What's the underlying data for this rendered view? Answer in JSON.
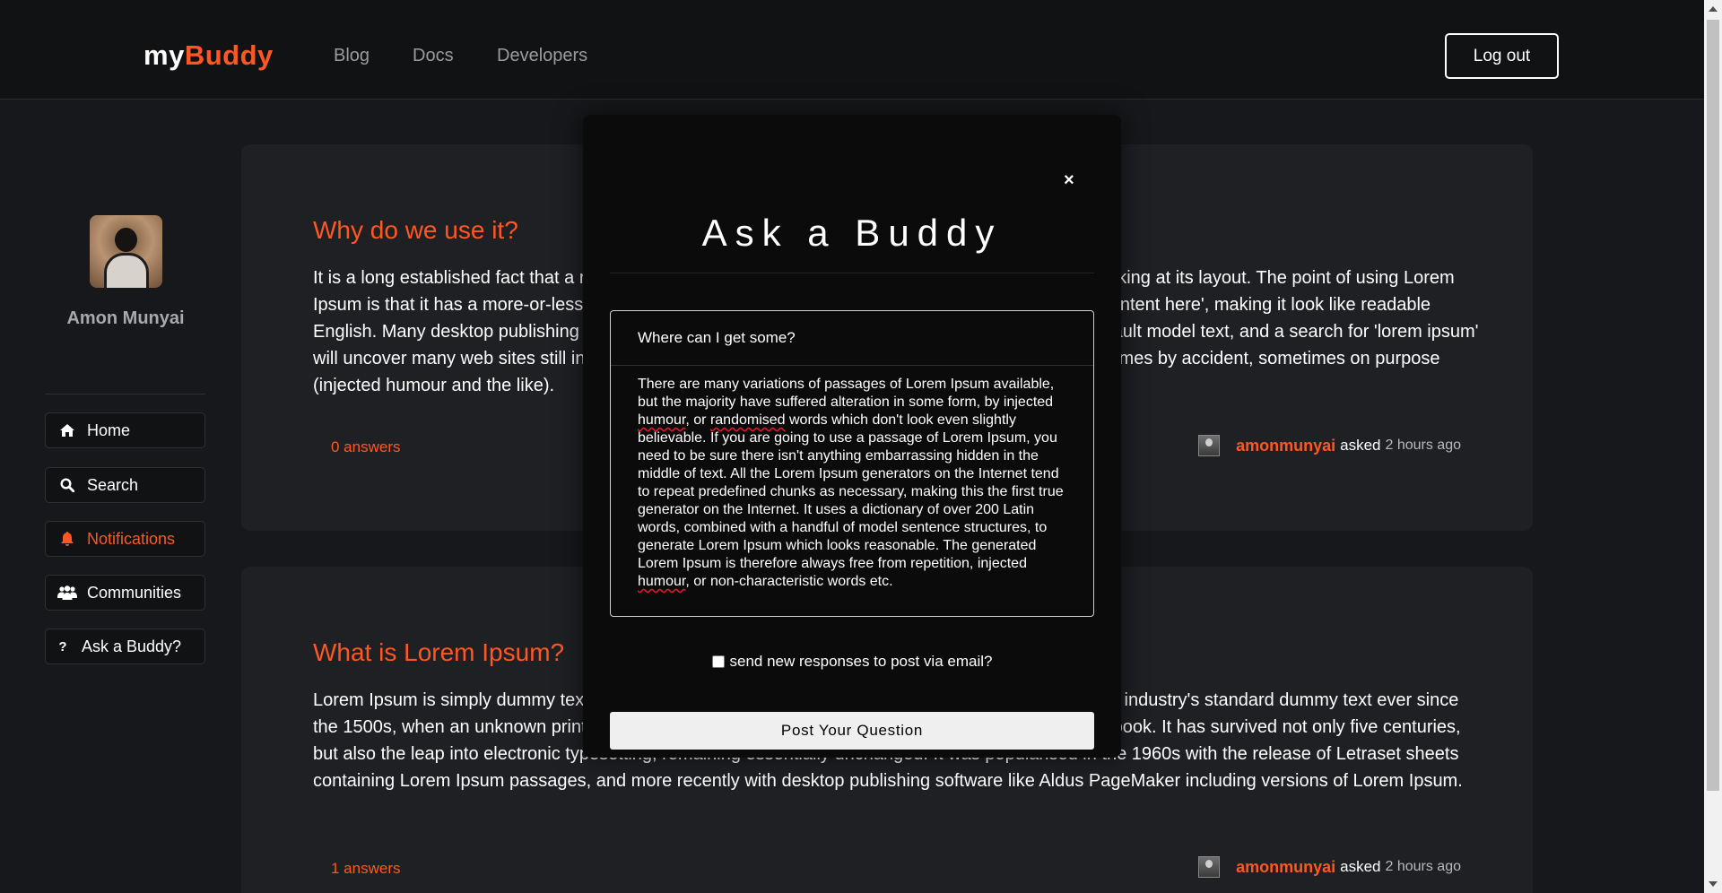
{
  "header": {
    "logo_part1": "my",
    "logo_part2": "Buddy",
    "nav": [
      "Blog",
      "Docs",
      "Developers"
    ],
    "logout_label": "Log out"
  },
  "sidebar": {
    "user_name": "Amon Munyai",
    "items": [
      {
        "label": "Home",
        "icon": "home-icon"
      },
      {
        "label": "Search",
        "icon": "search-icon"
      },
      {
        "label": "Notifications",
        "icon": "bell-icon",
        "active": true
      },
      {
        "label": "Communities",
        "icon": "users-icon"
      },
      {
        "label": "Ask a Buddy?",
        "icon": "question-icon"
      }
    ]
  },
  "posts": [
    {
      "title": "Why do we use it?",
      "body": "It is a long established fact that a reader will be distracted by the readable content of a page when looking at its layout. The point of using Lorem Ipsum is that it has a more-or-less normal distribution of letters, as opposed to using 'Content here, content here', making it look like readable English. Many desktop publishing packages and web page editors now use Lorem Ipsum as their default model text, and a search for 'lorem ipsum' will uncover many web sites still in their infancy. Various versions have evolved over the years, sometimes by accident, sometimes on purpose (injected humour and the like).",
      "answers": "0 answers",
      "author": "amonmunyai",
      "asked_word": "asked",
      "time": "2 hours ago"
    },
    {
      "title": "What is Lorem Ipsum?",
      "body": "Lorem Ipsum is simply dummy text of the printing and typesetting industry. Lorem Ipsum has been the industry's standard dummy text ever since the 1500s, when an unknown printer took a galley of type and scrambled it to make a type specimen book. It has survived not only five centuries, but also the leap into electronic typesetting, remaining essentially unchanged. It was popularised in the 1960s with the release of Letraset sheets containing Lorem Ipsum passages, and more recently with desktop publishing software like Aldus PageMaker including versions of Lorem Ipsum.",
      "answers": "1 answers",
      "author": "amonmunyai",
      "asked_word": "asked",
      "time": "2 hours ago"
    }
  ],
  "modal": {
    "close_label": "×",
    "title": "Ask a Buddy",
    "question_value": "Where can I get some?",
    "details_value": "There are many variations of passages of Lorem Ipsum available, but the majority have suffered alteration in some form, by injected humour, or randomised words which don't look even slightly believable. If you are going to use a passage of Lorem Ipsum, you need to be sure there isn't anything embarrassing hidden in the middle of text. All the Lorem Ipsum generators on the Internet tend to repeat predefined chunks as necessary, making this the first true generator on the Internet. It uses a dictionary of over 200 Latin words, combined with a handful of model sentence structures, to generate Lorem Ipsum which looks reasonable. The generated Lorem Ipsum is therefore always free from repetition, injected humour, or non-characteristic words etc.",
    "email_label": "send new responses to post via email?",
    "submit_label": "Post Your Question"
  },
  "colors": {
    "accent": "#ff5722",
    "background": "#17181b",
    "card": "#1f2024",
    "modal": "#0b0b0c"
  }
}
